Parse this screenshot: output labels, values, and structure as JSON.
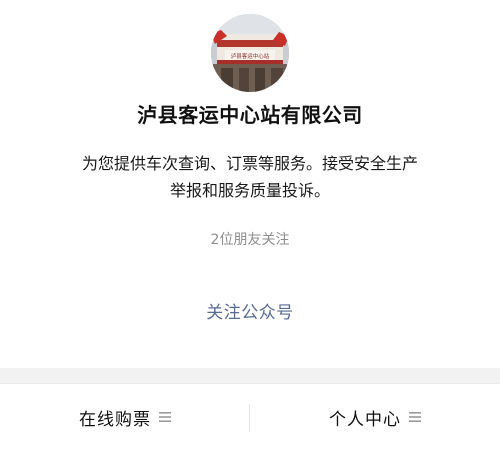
{
  "profile": {
    "avatar_icon": "station-building-photo",
    "avatar_sign": "泸县客运中心站",
    "name": "泸县客运中心站有限公司",
    "intro_lines": [
      "为您提供车次查询、订票等服务。接受安全生产",
      "举报和服务质量投诉。"
    ],
    "friends_following": "2位朋友关注",
    "follow_label": "关注公众号",
    "link_color": "#576b95"
  },
  "menu": {
    "items": [
      {
        "label": "在线购票",
        "icon": "menu-lines-icon"
      },
      {
        "label": "个人中心",
        "icon": "menu-lines-icon"
      }
    ]
  }
}
